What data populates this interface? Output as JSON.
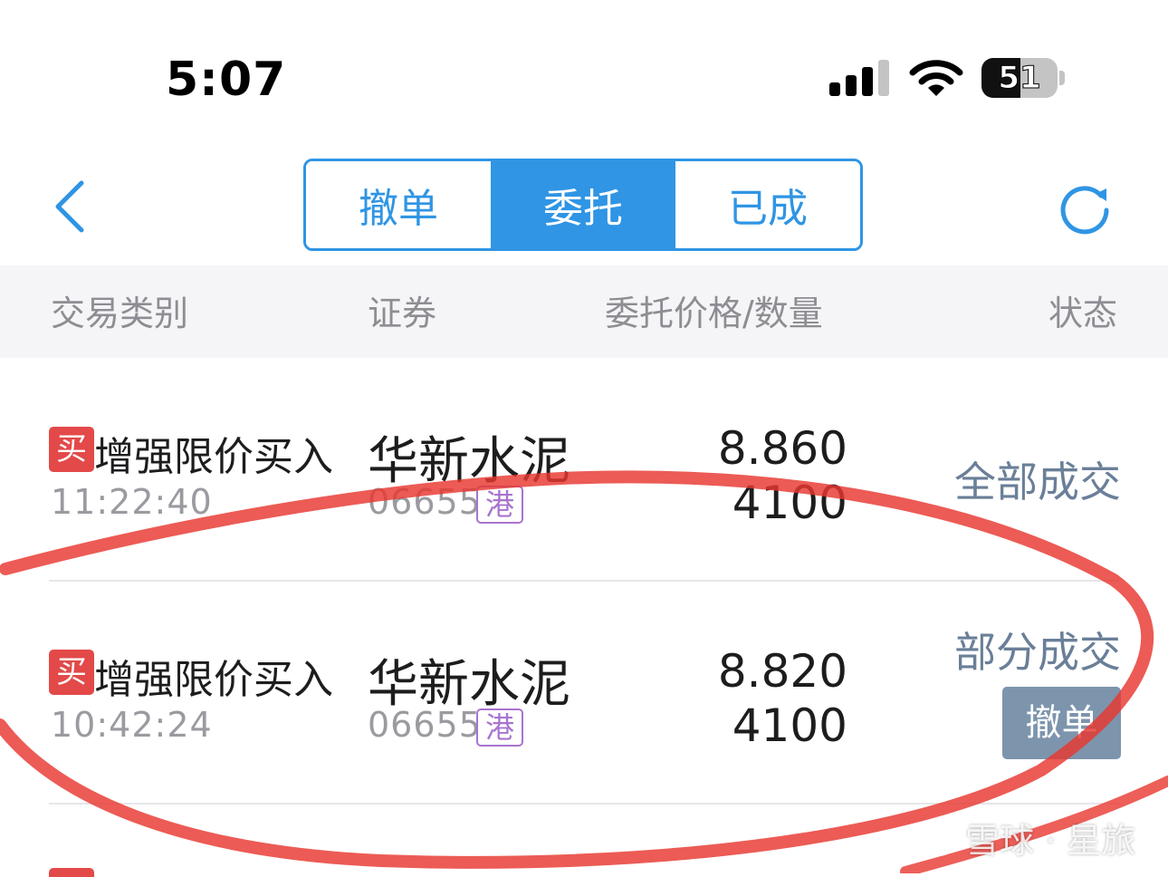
{
  "status_bar": {
    "time": "5:07",
    "battery_level": "51",
    "icons": [
      "cellular-signal-icon",
      "wifi-icon",
      "battery-icon"
    ]
  },
  "nav": {
    "back_icon": "chevron-left-icon",
    "refresh_icon": "refresh-icon",
    "tabs": [
      {
        "label": "撤单",
        "active": false
      },
      {
        "label": "委托",
        "active": true
      },
      {
        "label": "已成",
        "active": false
      }
    ]
  },
  "table_header": {
    "type": "交易类别",
    "security": "证券",
    "price_qty": "委托价格/数量",
    "status": "状态"
  },
  "orders": [
    {
      "side_tag": "买",
      "type": "增强限价买入",
      "time": "11:22:40",
      "name": "华新水泥",
      "code": "06655",
      "market": "港",
      "price": "8.860",
      "quantity": "4100",
      "status": "全部成交"
    },
    {
      "side_tag": "买",
      "type": "增强限价买入",
      "time": "10:42:24",
      "name": "华新水泥",
      "code": "06655",
      "market": "港",
      "price": "8.820",
      "quantity": "4100",
      "status": "部分成交",
      "action": "撤单"
    }
  ],
  "watermark": {
    "text": "雪球 · 星旅"
  },
  "colors": {
    "accent": "#2f95e4",
    "buy_tag": "#e34949",
    "market_tag": "#a874cf",
    "status_text": "#6a7f98",
    "cancel_button": "#7d94ad",
    "annotation": "#e8372f"
  }
}
